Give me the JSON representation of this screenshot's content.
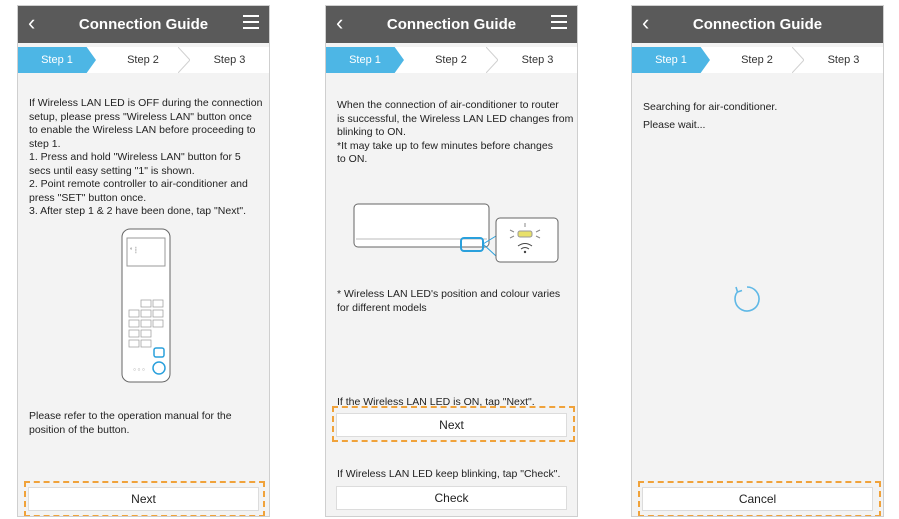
{
  "app": {
    "title": "Connection Guide",
    "steps": [
      "Step 1",
      "Step 2",
      "Step 3"
    ]
  },
  "screen1": {
    "instructions": [
      "If Wireless LAN LED is OFF during the connection",
      "setup, please press \"Wireless LAN\" button once",
      "to enable the Wireless LAN before proceeding to",
      "step 1.",
      "1. Press and hold \"Wireless LAN\" button for 5",
      "secs until easy setting \"1\" is shown.",
      "2. Point remote controller to air-conditioner and",
      "press \"SET\" button once.",
      "3. After step 1 & 2 have been done, tap \"Next\"."
    ],
    "note": [
      "Please refer to the operation manual for the",
      "position of the button."
    ],
    "next_label": "Next"
  },
  "screen2": {
    "instructions": [
      "When the connection of air-conditioner to router",
      "is successful, the Wireless LAN LED changes from",
      "blinking to ON.",
      "*It may take up to few minutes before changes",
      "to ON."
    ],
    "note": [
      "* Wireless LAN LED's position and colour varies",
      "for different models"
    ],
    "on_prompt": "If the Wireless LAN LED is ON, tap \"Next\".",
    "next_label": "Next",
    "blink_prompt": "If Wireless LAN LED keep blinking, tap \"Check\".",
    "check_label": "Check"
  },
  "screen3": {
    "status": "Searching for air-conditioner.",
    "wait": "Please wait...",
    "cancel_label": "Cancel"
  },
  "colors": {
    "header": "#5a5a5a",
    "step_active": "#4db6e5",
    "highlight": "#f0a23a"
  }
}
